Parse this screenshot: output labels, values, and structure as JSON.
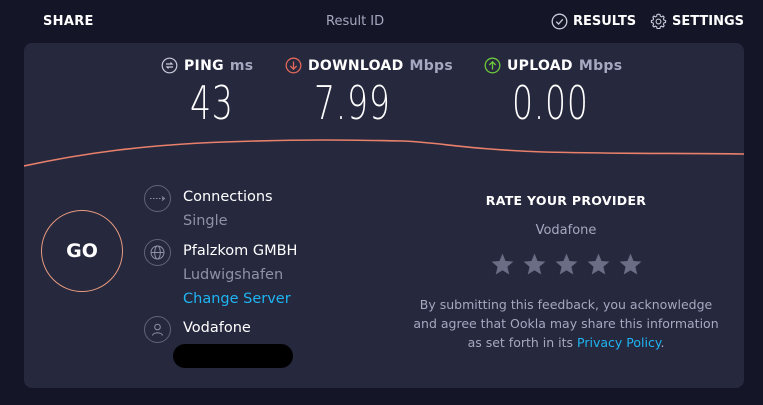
{
  "header": {
    "share_label": "SHARE",
    "result_id_label": "Result ID",
    "results_label": "RESULTS",
    "settings_label": "SETTINGS"
  },
  "metrics": {
    "ping": {
      "label": "PING",
      "unit": "ms",
      "value": "43"
    },
    "download": {
      "label": "DOWNLOAD",
      "unit": "Mbps",
      "value": "7.99"
    },
    "upload": {
      "label": "UPLOAD",
      "unit": "Mbps",
      "value": "0.00"
    }
  },
  "go_label": "GO",
  "connections": {
    "title": "Connections",
    "value": "Single"
  },
  "server": {
    "name": "Pfalzkom GMBH",
    "location": "Ludwigshafen",
    "change_label": "Change Server"
  },
  "isp": {
    "name": "Vodafone"
  },
  "rate": {
    "title": "RATE YOUR PROVIDER",
    "provider": "Vodafone",
    "stars": 5,
    "disclaimer_lines": [
      "By submitting this feedback, you acknowledge",
      "and agree that Ookla may share this information",
      "as set forth in its"
    ],
    "privacy_label": "Privacy Policy",
    "period": "."
  },
  "colors": {
    "background": "#141526",
    "panel": "#26283e",
    "accent_link": "#1fb4f2",
    "go_ring": "#e89a7f",
    "download_icon": "#e0685a",
    "upload_icon": "#6ec83c",
    "graph_line": "#e8806a",
    "muted_text": "#a5a8c0"
  }
}
